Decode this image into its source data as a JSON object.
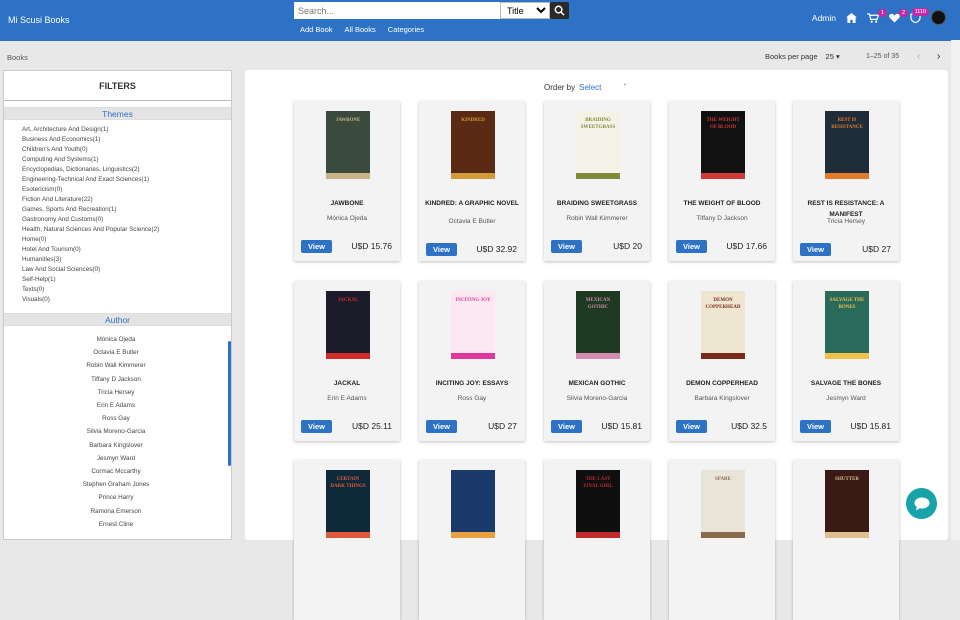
{
  "header": {
    "brand": "Mi Scusi Books",
    "search_placeholder": "Search...",
    "search_type": "Title",
    "nav": [
      "Add Book",
      "All Books",
      "Categories"
    ],
    "user": "Admin",
    "cart_count": "1",
    "wishlist_count": "2",
    "points": "1110"
  },
  "subbar": {
    "breadcrumb": "Books",
    "per_page_label": "Books per page",
    "per_page_value": "25",
    "range": "1–25 of 35"
  },
  "sidebar": {
    "title": "FILTERS",
    "themes_heading": "Themes",
    "themes": [
      "Art, Architecture And Design(1)",
      "Business And Economics(1)",
      "Children's And Youth(0)",
      "Computing And Systems(1)",
      "Encyclopedias, Dictionaries, Linguistics(2)",
      "Engineering-Technical And Exact Sciences(1)",
      "Esotericism(0)",
      "Fiction And Literature(22)",
      "Games, Sports And Recreation(1)",
      "Gastronomy And Customs(0)",
      "Health, Natural Sciences And Popular Science(2)",
      "Home(0)",
      "Hotel And Tourism(0)",
      "Humanities(3)",
      "Law And Social Sciences(0)",
      "Self-Help(1)",
      "Texts(0)",
      "Visuals(0)"
    ],
    "author_heading": "Author",
    "authors": [
      "Mónica Ojeda",
      "Octavia E Butler",
      "Robin Wall Kimmerer",
      "Tiffany D Jackson",
      "Tricia Hersey",
      "Erin E Adams",
      "Ross Gay",
      "Silvia Moreno-Garcia",
      "Barbara Kingslover",
      "Jesmyn Ward",
      "Cormac Mccarthy",
      "Stephen Graham Jones",
      "Prince Harry",
      "Ramona Emerson",
      "Ernest Cline"
    ]
  },
  "main": {
    "order_label": "Order by",
    "order_value": "Select",
    "view_label": "View",
    "books": [
      {
        "title": "JAWBONE",
        "author": "Mónica Ojeda",
        "price": "U$D 15.76",
        "cover": "#3a4a3c",
        "accent": "#c9b48a",
        "cover_text": "JAWBONE"
      },
      {
        "title": "KINDRED: A GRAPHIC NOVEL",
        "author": "Octavia E Butler",
        "price": "U$D 32.92",
        "cover": "#5a2a14",
        "accent": "#d19a3a",
        "cover_text": "KINDRED"
      },
      {
        "title": "BRAIDING SWEETGRASS",
        "author": "Robin Wall Kimmerer",
        "price": "U$D 20",
        "cover": "#f4f1e6",
        "accent": "#7f8a3a",
        "cover_text": "BRAIDING SWEETGRASS"
      },
      {
        "title": "THE WEIGHT OF BLOOD",
        "author": "Tiffany D Jackson",
        "price": "U$D 17.66",
        "cover": "#111111",
        "accent": "#d23a3a",
        "cover_text": "THE WEIGHT OF BLOOD"
      },
      {
        "title": "REST IS RESISTANCE: A MANIFEST",
        "author": "Tricia Hersey",
        "price": "U$D 27",
        "cover": "#1f2d3a",
        "accent": "#e57a2a",
        "cover_text": "REST IS RESISTANCE"
      },
      {
        "title": "JACKAL",
        "author": "Erin E Adams",
        "price": "U$D 25.11",
        "cover": "#1b1b2a",
        "accent": "#d32a2a",
        "cover_text": "JACKAL"
      },
      {
        "title": "INCITING JOY: ESSAYS",
        "author": "Ross Gay",
        "price": "U$D 27",
        "cover": "#fbe8f0",
        "accent": "#e0389a",
        "cover_text": "INCITING JOY"
      },
      {
        "title": "MEXICAN GOTHIC",
        "author": "Silvia Moreno-Garcia",
        "price": "U$D 15.81",
        "cover": "#1f3a22",
        "accent": "#d58ab0",
        "cover_text": "MEXICAN GOTHIC"
      },
      {
        "title": "DEMON COPPERHEAD",
        "author": "Barbara Kingslover",
        "price": "U$D 32.5",
        "cover": "#efe6d2",
        "accent": "#7a2a1a",
        "cover_text": "DEMON COPPERHEAD"
      },
      {
        "title": "SALVAGE THE BONES",
        "author": "Jesmyn Ward",
        "price": "U$D 15.81",
        "cover": "#2a6a5a",
        "accent": "#f0c04a",
        "cover_text": "SALVAGE THE BONES"
      },
      {
        "title": "",
        "author": "",
        "price": "",
        "cover": "#0e2a3a",
        "accent": "#e05a3a",
        "cover_text": "CERTAIN DARK THINGS"
      },
      {
        "title": "",
        "author": "",
        "price": "",
        "cover": "#1a3a6a",
        "accent": "#e8a040",
        "cover_text": ""
      },
      {
        "title": "",
        "author": "",
        "price": "",
        "cover": "#0f0f0f",
        "accent": "#c02a2a",
        "cover_text": "THE LAST FINAL GIRL"
      },
      {
        "title": "",
        "author": "",
        "price": "",
        "cover": "#e9e4d8",
        "accent": "#8a6a4a",
        "cover_text": "SPARE"
      },
      {
        "title": "",
        "author": "",
        "price": "",
        "cover": "#3a1a14",
        "accent": "#e0c090",
        "cover_text": "SHUTTER"
      }
    ]
  },
  "colors": {
    "primary": "#2d72c5",
    "badge": "#c02aa5",
    "chat": "#18a3a8"
  }
}
